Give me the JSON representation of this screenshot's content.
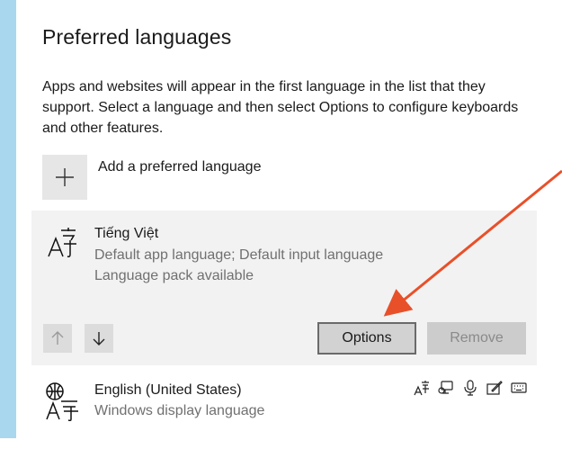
{
  "page": {
    "title": "Preferred languages",
    "intro": "Apps and websites will appear in the first language in the list that they support. Select a language and then select Options to configure keyboards and other features.",
    "accent_color": "#a9d8ee"
  },
  "add_language": {
    "label": "Add a preferred language"
  },
  "languages": [
    {
      "name": "Tiếng Việt",
      "line1": "Default app language; Default input language",
      "line2": "Language pack available",
      "icon": "language-icon",
      "selected": true
    },
    {
      "name": "English (United States)",
      "line1": "Windows display language",
      "icon": "language-pack-icon",
      "features": [
        "display-language-icon",
        "text-to-speech-icon",
        "speech-recognition-icon",
        "handwriting-icon",
        "keyboard-icon"
      ]
    }
  ],
  "actions": {
    "move_up_icon": "arrow-up-icon",
    "move_down_icon": "arrow-down-icon",
    "options_label": "Options",
    "remove_label": "Remove"
  },
  "annotation": {
    "color": "#e8502a"
  }
}
